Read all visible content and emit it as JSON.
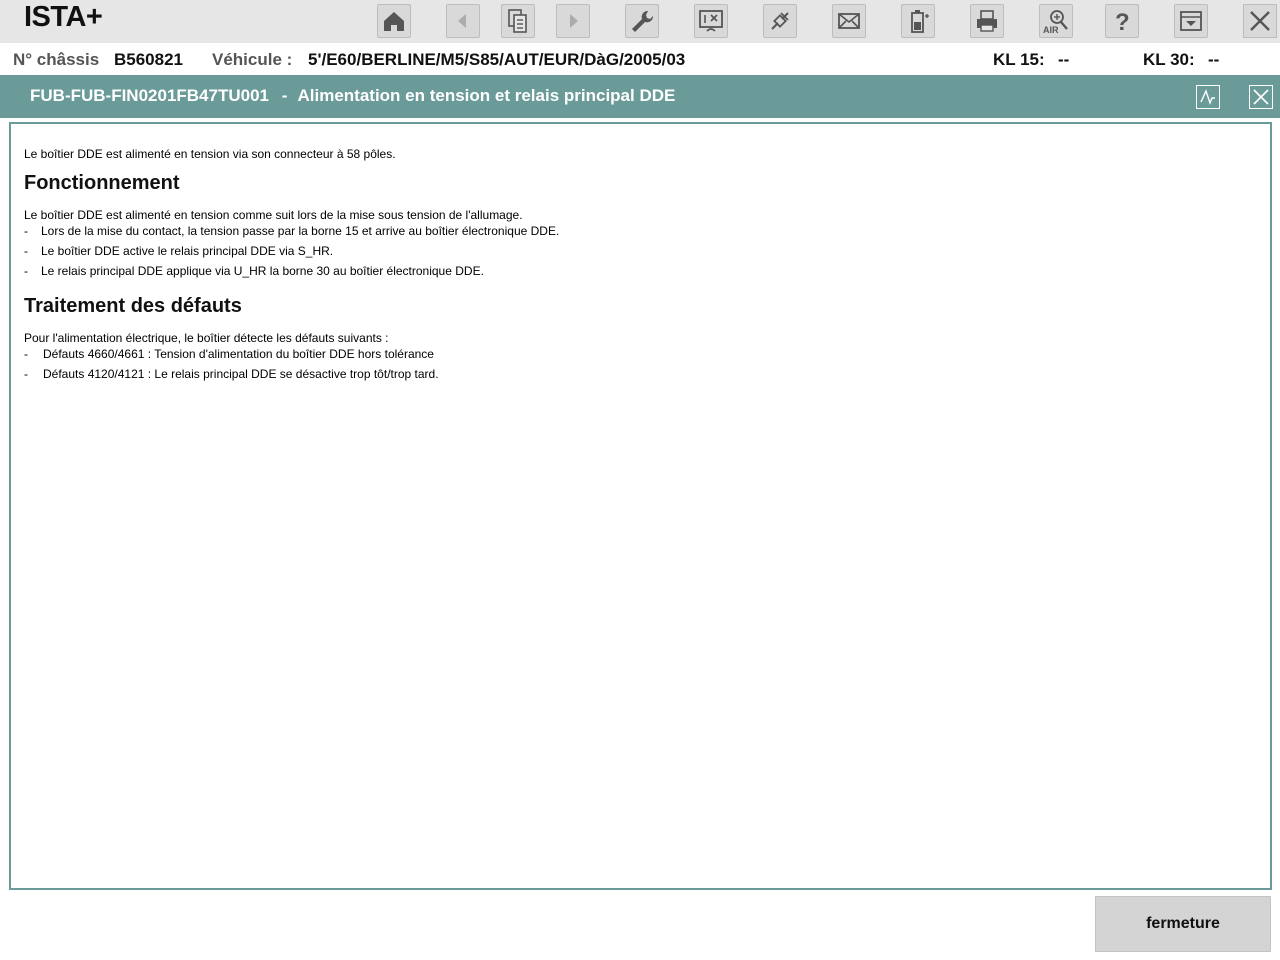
{
  "app": {
    "title": "ISTA+"
  },
  "toolbar": {
    "buttons": [
      {
        "icon": "home-icon",
        "enabled": true
      },
      {
        "icon": "back-arrow-icon",
        "enabled": false
      },
      {
        "icon": "documents-icon",
        "enabled": true
      },
      {
        "icon": "forward-arrow-icon",
        "enabled": false
      },
      {
        "icon": "wrench-icon",
        "enabled": true
      },
      {
        "icon": "control-unit-icon",
        "enabled": true
      },
      {
        "icon": "connector-icon",
        "enabled": true
      },
      {
        "icon": "mail-icon",
        "enabled": true
      },
      {
        "icon": "battery-icon",
        "enabled": true
      },
      {
        "icon": "print-icon",
        "enabled": true
      },
      {
        "icon": "air-search-icon",
        "enabled": true,
        "label": "AIR"
      },
      {
        "icon": "help-icon",
        "enabled": true
      },
      {
        "icon": "minimize-icon",
        "enabled": true
      },
      {
        "icon": "close-icon",
        "enabled": true
      }
    ]
  },
  "vehicle": {
    "chassis_label": "N° châssis",
    "chassis_value": "B560821",
    "vehicle_label": "Véhicule :",
    "vehicle_value": "5'/E60/BERLINE/M5/S85/AUT/EUR/DàG/2005/03",
    "kl15_label": "KL 15:",
    "kl15_value": "--",
    "kl30_label": "KL 30:",
    "kl30_value": "--"
  },
  "document": {
    "code": "FUB-FUB-FIN0201FB47TU001",
    "separator": "-",
    "title": "Alimentation en tension et relais principal DDE",
    "intro": "Le boîtier DDE est alimenté en tension via son connecteur à 58 pôles.",
    "section1": {
      "heading": "Fonctionnement",
      "text": "Le boîtier DDE est alimenté en tension comme suit lors de la mise sous tension de l'allumage.",
      "items": [
        "Lors de la mise du contact, la tension passe par la borne 15 et arrive au boîtier électronique DDE.",
        "Le boîtier DDE active le relais principal DDE via S_HR.",
        "Le relais principal DDE applique via U_HR la borne 30 au boîtier électronique DDE."
      ]
    },
    "section2": {
      "heading": "Traitement des défauts",
      "text": "Pour l'alimentation électrique, le boîtier détecte les défauts suivants :",
      "items": [
        "Défauts 4660/4661 : Tension d'alimentation du boîtier DDE hors tolérance",
        "Défauts 4120/4121 : Le relais principal DDE se désactive trop tôt/trop tard."
      ]
    },
    "dash": "-"
  },
  "footer": {
    "close_label": "fermeture"
  },
  "colors": {
    "accent": "#6a9b99",
    "toolbar_bg": "#e6e6e6",
    "button_bg": "#d4d4d4"
  }
}
